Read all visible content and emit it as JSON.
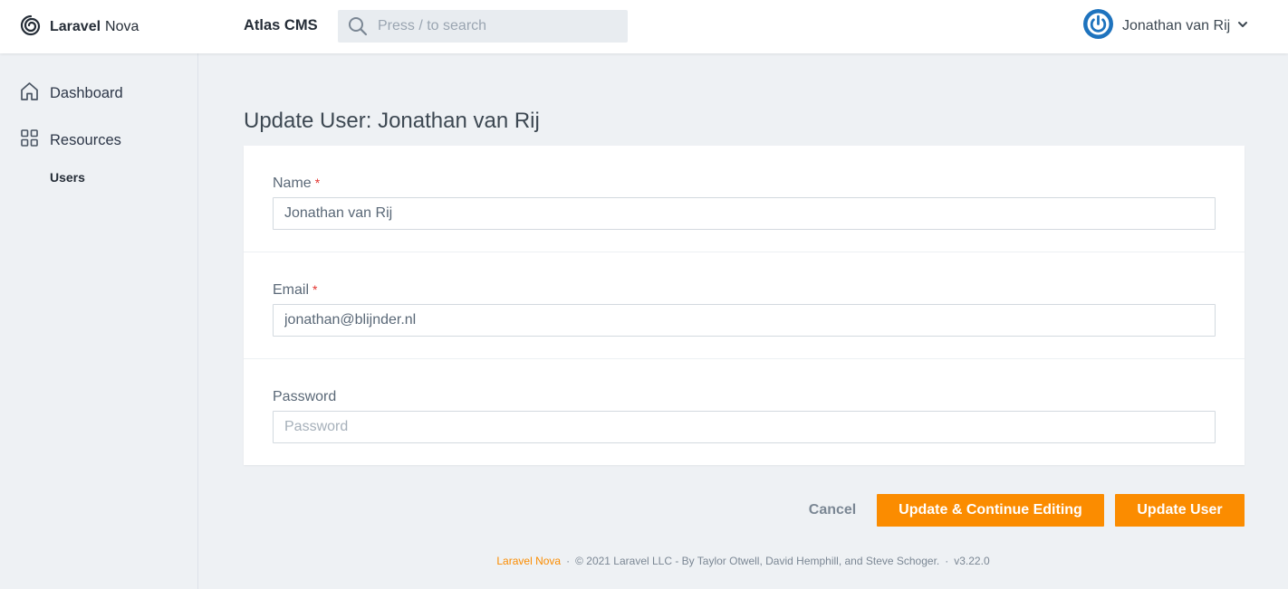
{
  "brand": {
    "bold": "Laravel",
    "light": "Nova",
    "icon": "nova-swirl-icon"
  },
  "header": {
    "app_name": "Atlas CMS",
    "search_placeholder": "Press / to search",
    "user_name": "Jonathan van Rij"
  },
  "sidebar": {
    "items": [
      {
        "label": "Dashboard",
        "icon": "home-icon"
      },
      {
        "label": "Resources",
        "icon": "grid-icon"
      }
    ],
    "sub_items": [
      {
        "label": "Users"
      }
    ]
  },
  "page": {
    "title": "Update User: Jonathan van Rij"
  },
  "form": {
    "fields": [
      {
        "label": "Name",
        "required": "*",
        "value": "Jonathan van Rij",
        "placeholder": ""
      },
      {
        "label": "Email",
        "required": "*",
        "value": "jonathan@blijnder.nl",
        "placeholder": ""
      },
      {
        "label": "Password",
        "value": "",
        "placeholder": "Password"
      }
    ]
  },
  "actions": {
    "cancel": "Cancel",
    "update_continue": "Update & Continue Editing",
    "update": "Update User"
  },
  "footer": {
    "link": "Laravel Nova",
    "separator": "·",
    "copyright": "© 2021 Laravel LLC - By Taylor Otwell, David Hemphill, and Steve Schoger.",
    "version": "v3.22.0"
  },
  "colors": {
    "accent": "#fb8c00",
    "avatar": "#1e73be",
    "background": "#eef1f4"
  }
}
